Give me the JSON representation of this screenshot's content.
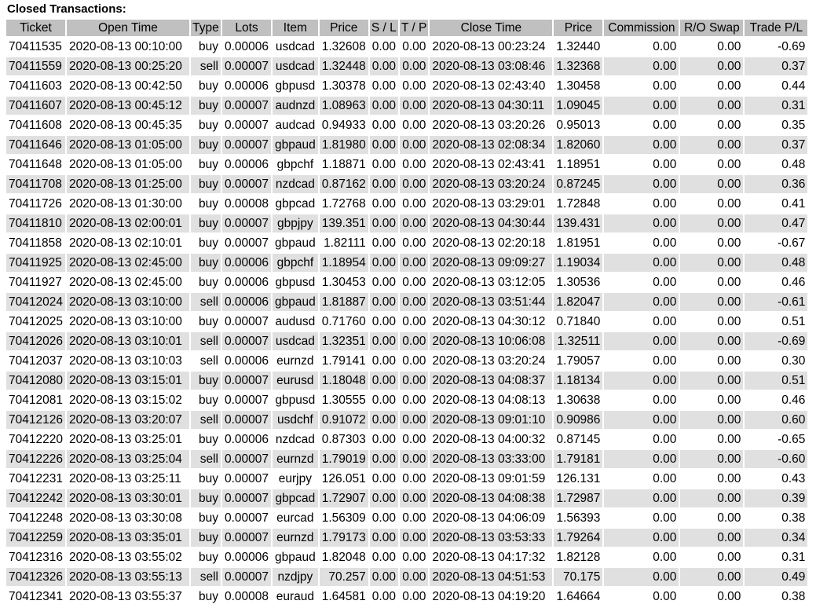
{
  "page": {
    "title": "Closed Transactions:"
  },
  "table": {
    "headers": [
      "Ticket",
      "Open Time",
      "Type",
      "Lots",
      "Item",
      "Price",
      "S / L",
      "T / P",
      "Close Time",
      "Price",
      "Commission",
      "R/O Swap",
      "Trade P/L"
    ],
    "rows": [
      [
        "70411535",
        "2020-08-13 00:10:00",
        "buy",
        "0.00006",
        "usdcad",
        "1.32608",
        "0.00",
        "0.00",
        "2020-08-13 00:23:24",
        "1.32440",
        "0.00",
        "0.00",
        "-0.69"
      ],
      [
        "70411559",
        "2020-08-13 00:25:20",
        "sell",
        "0.00007",
        "usdcad",
        "1.32448",
        "0.00",
        "0.00",
        "2020-08-13 03:08:46",
        "1.32368",
        "0.00",
        "0.00",
        "0.37"
      ],
      [
        "70411603",
        "2020-08-13 00:42:50",
        "buy",
        "0.00006",
        "gbpusd",
        "1.30378",
        "0.00",
        "0.00",
        "2020-08-13 02:43:40",
        "1.30458",
        "0.00",
        "0.00",
        "0.44"
      ],
      [
        "70411607",
        "2020-08-13 00:45:12",
        "buy",
        "0.00007",
        "audnzd",
        "1.08963",
        "0.00",
        "0.00",
        "2020-08-13 04:30:11",
        "1.09045",
        "0.00",
        "0.00",
        "0.31"
      ],
      [
        "70411608",
        "2020-08-13 00:45:35",
        "buy",
        "0.00007",
        "audcad",
        "0.94933",
        "0.00",
        "0.00",
        "2020-08-13 03:20:26",
        "0.95013",
        "0.00",
        "0.00",
        "0.35"
      ],
      [
        "70411646",
        "2020-08-13 01:05:00",
        "buy",
        "0.00007",
        "gbpaud",
        "1.81980",
        "0.00",
        "0.00",
        "2020-08-13 02:08:34",
        "1.82060",
        "0.00",
        "0.00",
        "0.37"
      ],
      [
        "70411648",
        "2020-08-13 01:05:00",
        "buy",
        "0.00006",
        "gbpchf",
        "1.18871",
        "0.00",
        "0.00",
        "2020-08-13 02:43:41",
        "1.18951",
        "0.00",
        "0.00",
        "0.48"
      ],
      [
        "70411708",
        "2020-08-13 01:25:00",
        "buy",
        "0.00007",
        "nzdcad",
        "0.87162",
        "0.00",
        "0.00",
        "2020-08-13 03:20:24",
        "0.87245",
        "0.00",
        "0.00",
        "0.36"
      ],
      [
        "70411726",
        "2020-08-13 01:30:00",
        "buy",
        "0.00008",
        "gbpcad",
        "1.72768",
        "0.00",
        "0.00",
        "2020-08-13 03:29:01",
        "1.72848",
        "0.00",
        "0.00",
        "0.41"
      ],
      [
        "70411810",
        "2020-08-13 02:00:01",
        "buy",
        "0.00007",
        "gbpjpy",
        "139.351",
        "0.00",
        "0.00",
        "2020-08-13 04:30:44",
        "139.431",
        "0.00",
        "0.00",
        "0.47"
      ],
      [
        "70411858",
        "2020-08-13 02:10:01",
        "buy",
        "0.00007",
        "gbpaud",
        "1.82111",
        "0.00",
        "0.00",
        "2020-08-13 02:20:18",
        "1.81951",
        "0.00",
        "0.00",
        "-0.67"
      ],
      [
        "70411925",
        "2020-08-13 02:45:00",
        "buy",
        "0.00006",
        "gbpchf",
        "1.18954",
        "0.00",
        "0.00",
        "2020-08-13 09:09:27",
        "1.19034",
        "0.00",
        "0.00",
        "0.48"
      ],
      [
        "70411927",
        "2020-08-13 02:45:00",
        "buy",
        "0.00006",
        "gbpusd",
        "1.30453",
        "0.00",
        "0.00",
        "2020-08-13 03:12:05",
        "1.30536",
        "0.00",
        "0.00",
        "0.46"
      ],
      [
        "70412024",
        "2020-08-13 03:10:00",
        "sell",
        "0.00006",
        "gbpaud",
        "1.81887",
        "0.00",
        "0.00",
        "2020-08-13 03:51:44",
        "1.82047",
        "0.00",
        "0.00",
        "-0.61"
      ],
      [
        "70412025",
        "2020-08-13 03:10:00",
        "buy",
        "0.00007",
        "audusd",
        "0.71760",
        "0.00",
        "0.00",
        "2020-08-13 04:30:12",
        "0.71840",
        "0.00",
        "0.00",
        "0.51"
      ],
      [
        "70412026",
        "2020-08-13 03:10:01",
        "sell",
        "0.00007",
        "usdcad",
        "1.32351",
        "0.00",
        "0.00",
        "2020-08-13 10:06:08",
        "1.32511",
        "0.00",
        "0.00",
        "-0.69"
      ],
      [
        "70412037",
        "2020-08-13 03:10:03",
        "sell",
        "0.00006",
        "eurnzd",
        "1.79141",
        "0.00",
        "0.00",
        "2020-08-13 03:20:24",
        "1.79057",
        "0.00",
        "0.00",
        "0.30"
      ],
      [
        "70412080",
        "2020-08-13 03:15:01",
        "buy",
        "0.00007",
        "eurusd",
        "1.18048",
        "0.00",
        "0.00",
        "2020-08-13 04:08:37",
        "1.18134",
        "0.00",
        "0.00",
        "0.51"
      ],
      [
        "70412081",
        "2020-08-13 03:15:02",
        "buy",
        "0.00007",
        "gbpusd",
        "1.30555",
        "0.00",
        "0.00",
        "2020-08-13 04:08:13",
        "1.30638",
        "0.00",
        "0.00",
        "0.46"
      ],
      [
        "70412126",
        "2020-08-13 03:20:07",
        "sell",
        "0.00007",
        "usdchf",
        "0.91072",
        "0.00",
        "0.00",
        "2020-08-13 09:01:10",
        "0.90986",
        "0.00",
        "0.00",
        "0.60"
      ],
      [
        "70412220",
        "2020-08-13 03:25:01",
        "buy",
        "0.00006",
        "nzdcad",
        "0.87303",
        "0.00",
        "0.00",
        "2020-08-13 04:00:32",
        "0.87145",
        "0.00",
        "0.00",
        "-0.65"
      ],
      [
        "70412226",
        "2020-08-13 03:25:04",
        "sell",
        "0.00007",
        "eurnzd",
        "1.79019",
        "0.00",
        "0.00",
        "2020-08-13 03:33:00",
        "1.79181",
        "0.00",
        "0.00",
        "-0.60"
      ],
      [
        "70412231",
        "2020-08-13 03:25:11",
        "buy",
        "0.00007",
        "eurjpy",
        "126.051",
        "0.00",
        "0.00",
        "2020-08-13 09:01:59",
        "126.131",
        "0.00",
        "0.00",
        "0.43"
      ],
      [
        "70412242",
        "2020-08-13 03:30:01",
        "buy",
        "0.00007",
        "gbpcad",
        "1.72907",
        "0.00",
        "0.00",
        "2020-08-13 04:08:38",
        "1.72987",
        "0.00",
        "0.00",
        "0.39"
      ],
      [
        "70412248",
        "2020-08-13 03:30:08",
        "buy",
        "0.00007",
        "eurcad",
        "1.56309",
        "0.00",
        "0.00",
        "2020-08-13 04:06:09",
        "1.56393",
        "0.00",
        "0.00",
        "0.38"
      ],
      [
        "70412259",
        "2020-08-13 03:35:01",
        "buy",
        "0.00007",
        "eurnzd",
        "1.79173",
        "0.00",
        "0.00",
        "2020-08-13 03:53:33",
        "1.79264",
        "0.00",
        "0.00",
        "0.34"
      ],
      [
        "70412316",
        "2020-08-13 03:55:02",
        "buy",
        "0.00006",
        "gbpaud",
        "1.82048",
        "0.00",
        "0.00",
        "2020-08-13 04:17:32",
        "1.82128",
        "0.00",
        "0.00",
        "0.31"
      ],
      [
        "70412326",
        "2020-08-13 03:55:13",
        "sell",
        "0.00007",
        "nzdjpy",
        "70.257",
        "0.00",
        "0.00",
        "2020-08-13 04:51:53",
        "70.175",
        "0.00",
        "0.00",
        "0.49"
      ],
      [
        "70412341",
        "2020-08-13 03:55:37",
        "buy",
        "0.00008",
        "euraud",
        "1.64581",
        "0.00",
        "0.00",
        "2020-08-13 04:19:20",
        "1.64664",
        "0.00",
        "0.00",
        "0.38"
      ]
    ]
  },
  "colors": {
    "header_bg": "#c0c0c0",
    "shaded_row_bg": "#e0e0e0",
    "plain_row_bg": "#ffffff"
  }
}
